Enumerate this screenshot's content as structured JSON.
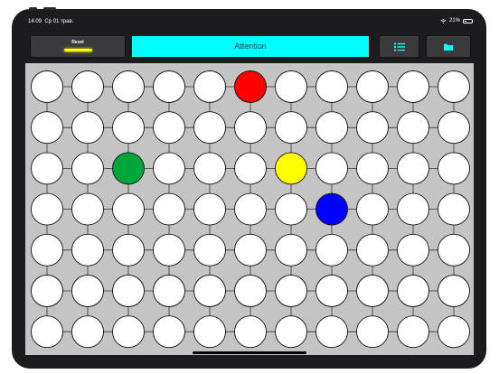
{
  "status_bar": {
    "time": "14:09",
    "date": "Ср 01 трав.",
    "battery": "21%"
  },
  "toolbar": {
    "reset_label": "Reset",
    "reset_indicator_color": "#ffff00",
    "title": "Attention",
    "title_bg_color": "#00ffff",
    "list_icon": "list-icon",
    "folder_icon": "folder-icon",
    "icon_color": "#00ffff"
  },
  "board": {
    "rows": 7,
    "cols": 11,
    "empty_color": "#ffffff",
    "background_color": "#c4c4c4",
    "colored_cells": [
      {
        "row": 0,
        "col": 5,
        "color": "#ff0000"
      },
      {
        "row": 2,
        "col": 2,
        "color": "#00a63a"
      },
      {
        "row": 2,
        "col": 6,
        "color": "#ffff00"
      },
      {
        "row": 3,
        "col": 7,
        "color": "#0000ff"
      }
    ]
  }
}
